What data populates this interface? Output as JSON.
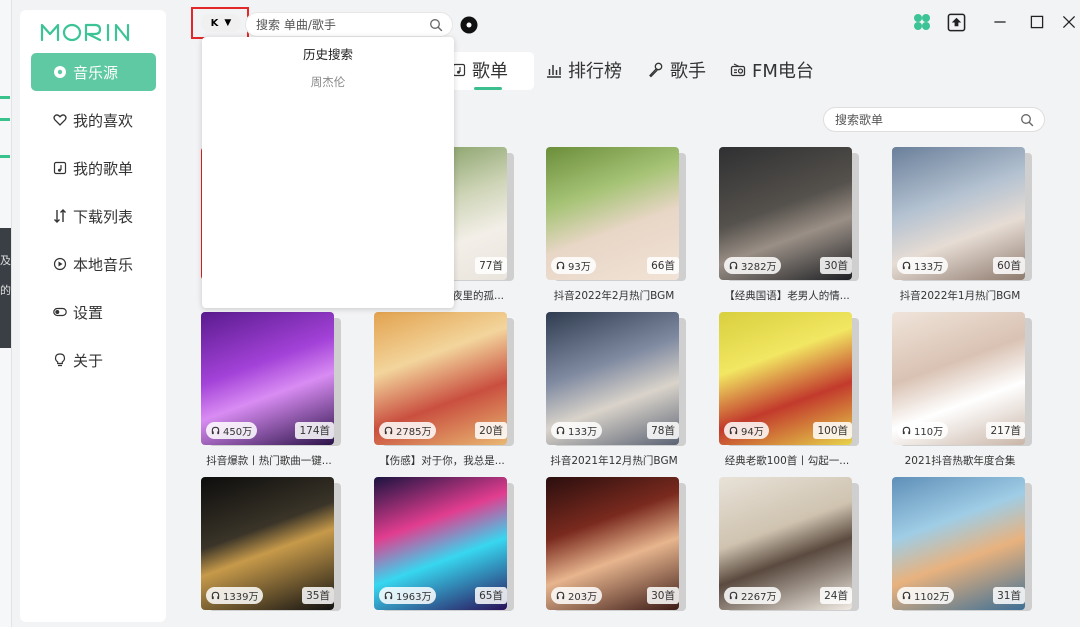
{
  "app": {
    "logo_text": "MORIN"
  },
  "sidebar": {
    "items": [
      {
        "label": "音乐源",
        "icon": "source-icon",
        "active": true
      },
      {
        "label": "我的喜欢",
        "icon": "heart-icon",
        "active": false
      },
      {
        "label": "我的歌单",
        "icon": "playlist-icon",
        "active": false
      },
      {
        "label": "下载列表",
        "icon": "download-icon",
        "active": false
      },
      {
        "label": "本地音乐",
        "icon": "local-music-icon",
        "active": false
      },
      {
        "label": "设置",
        "icon": "settings-toggle-icon",
        "active": false
      },
      {
        "label": "关于",
        "icon": "bulb-icon",
        "active": false
      }
    ]
  },
  "topbar": {
    "source_label": "K",
    "search_placeholder": "搜索 单曲/歌手"
  },
  "history": {
    "title": "历史搜索",
    "items": [
      "周杰伦"
    ]
  },
  "tabs": [
    {
      "label": "歌单",
      "icon": "playlist-icon",
      "active": true
    },
    {
      "label": "排行榜",
      "icon": "chart-icon",
      "active": false
    },
    {
      "label": "歌手",
      "icon": "singer-icon",
      "active": false
    },
    {
      "label": "FM电台",
      "icon": "radio-icon",
      "active": false
    }
  ],
  "playlist_search_placeholder": "搜索歌单",
  "background_window": {
    "fragments": [
      "及",
      "的"
    ]
  },
  "colors": {
    "accent": "#5ec9a2",
    "highlight_border": "#e22828"
  },
  "playlists": [
    {
      "plays": "",
      "count": "",
      "title": "",
      "cover": "c0"
    },
    {
      "plays": "",
      "count": "77首",
      "title": "夜里的孤...",
      "cover": "c1"
    },
    {
      "plays": "93万",
      "count": "66首",
      "title": "抖音2022年2月热门BGM",
      "cover": "c2"
    },
    {
      "plays": "3282万",
      "count": "30首",
      "title": "【经典国语】老男人的情...",
      "cover": "c3"
    },
    {
      "plays": "133万",
      "count": "60首",
      "title": "抖音2022年1月热门BGM",
      "cover": "c4"
    },
    {
      "plays": "450万",
      "count": "174首",
      "title": "抖音爆款丨热门歌曲一键...",
      "cover": "c5"
    },
    {
      "plays": "2785万",
      "count": "20首",
      "title": "【伤感】对于你，我总是...",
      "cover": "c6"
    },
    {
      "plays": "133万",
      "count": "78首",
      "title": "抖音2021年12月热门BGM",
      "cover": "c7"
    },
    {
      "plays": "94万",
      "count": "100首",
      "title": "经典老歌100首丨勾起一...",
      "cover": "c8"
    },
    {
      "plays": "110万",
      "count": "217首",
      "title": "2021抖音热歌年度合集",
      "cover": "c9"
    },
    {
      "plays": "1339万",
      "count": "35首",
      "title": "",
      "cover": "c10"
    },
    {
      "plays": "1963万",
      "count": "65首",
      "title": "",
      "cover": "c11"
    },
    {
      "plays": "203万",
      "count": "30首",
      "title": "",
      "cover": "c12"
    },
    {
      "plays": "2267万",
      "count": "24首",
      "title": "",
      "cover": "c13"
    },
    {
      "plays": "1102万",
      "count": "31首",
      "title": "",
      "cover": "c14"
    }
  ]
}
